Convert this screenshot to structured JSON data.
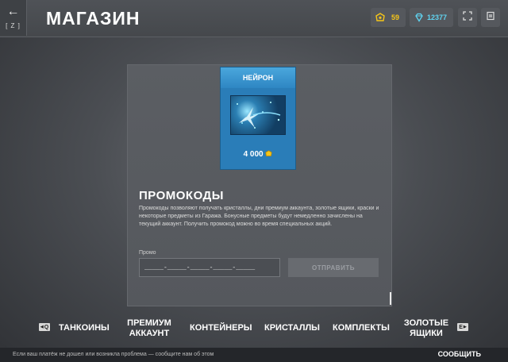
{
  "header": {
    "back_key": "[ Z ]",
    "title": "МАГАЗИН",
    "gold_value": "59",
    "crystals_value": "12377"
  },
  "colors": {
    "gold": "#f5c518",
    "crystal": "#5fd3f0",
    "card_blue": "#2a7db8"
  },
  "card": {
    "name": "НЕЙРОН",
    "price": "4 000"
  },
  "promo": {
    "title": "ПРОМОКОДЫ",
    "description": "Промокоды позволяют получать кристаллы, дни премиум аккаунта, золотые ящики, краски и некоторые предметы из Гаража. Бонусные предметы будут немедленно зачислены на текущий аккаунт. Получить промокод можно во время специальных акций.",
    "field_label": "Промо",
    "input_value": "_____-_____-_____-_____-_____",
    "submit_label": "ОТПРАВИТЬ"
  },
  "tabs": {
    "prev_key": "Q",
    "next_key": "E",
    "items": [
      {
        "label": "ТАНКОИНЫ"
      },
      {
        "label": "ПРЕМИУМ",
        "label2": "АККАУНТ"
      },
      {
        "label": "КОНТЕЙНЕРЫ"
      },
      {
        "label": "КРИСТАЛЛЫ"
      },
      {
        "label": "КОМПЛЕКТЫ"
      },
      {
        "label": "ЗОЛОТЫЕ",
        "label2": "ЯЩИКИ"
      }
    ]
  },
  "footer": {
    "text": "Если ваш платёж не дошел или возникла проблема — сообщите нам об этом",
    "report_label": "СООБЩИТЬ"
  }
}
